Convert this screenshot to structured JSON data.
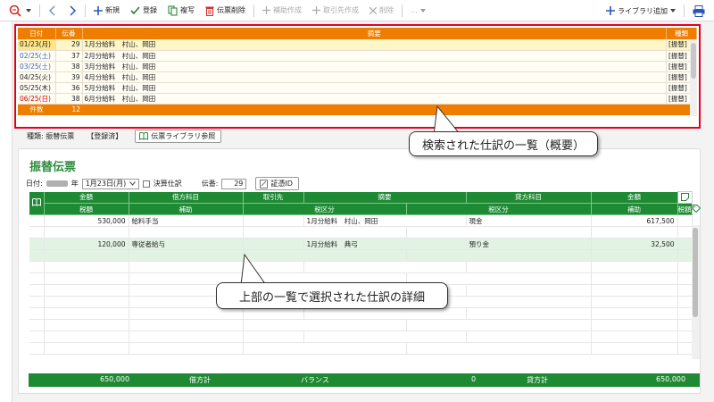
{
  "toolbar": {
    "new": "新規",
    "register": "登録",
    "duplicate": "複写",
    "delete_voucher": "伝票削除",
    "aux_create": "補助作成",
    "partner_create": "取引先作成",
    "delete": "削除",
    "more": "…",
    "library_add": "ライブラリ追加"
  },
  "list": {
    "headers": {
      "date": "日付",
      "no": "伝番",
      "summary": "摘要",
      "type": "種類"
    },
    "rows": [
      {
        "date": "01/23(月)",
        "no": "29",
        "summary": "1月分給料　村山、岡田",
        "type": "[振替]"
      },
      {
        "date": "02/25(土)",
        "no": "37",
        "summary": "2月分給料　村山、岡田",
        "type": "[振替]"
      },
      {
        "date": "03/25(土)",
        "no": "38",
        "summary": "3月分給料　村山、岡田",
        "type": "[振替]"
      },
      {
        "date": "04/25(火)",
        "no": "39",
        "summary": "4月分給料　村山、岡田",
        "type": "[振替]"
      },
      {
        "date": "05/25(木)",
        "no": "36",
        "summary": "5月分給料　村山、岡田",
        "type": "[振替]"
      },
      {
        "date": "06/25(日)",
        "no": "38",
        "summary": "6月分給料　村山、岡田",
        "type": "[振替]"
      }
    ],
    "footer_label": "件数",
    "footer_count": "12"
  },
  "info": {
    "type_label": "種類:",
    "type_value": "振替伝票",
    "status": "【登録済】",
    "library_ref": "伝票ライブラリ参照"
  },
  "voucher": {
    "title": "振替伝票",
    "date_label": "日付:",
    "year_suffix": "年",
    "date_value": "1月23日(月)",
    "closing": "決算仕訳",
    "no_label": "伝番:",
    "no_value": "29",
    "evidence": "証憑ID"
  },
  "grid": {
    "h1": [
      "金額",
      "借方科目",
      "取引先",
      "摘要",
      "貸方科目",
      "金額"
    ],
    "h2": [
      "税額",
      "補助",
      "税区分",
      "税区分",
      "補助",
      "税額"
    ],
    "rows": [
      {
        "amt": "530,000",
        "debit": "給料手当",
        "summary": "1月分給料　村山、岡田",
        "credit": "現金",
        "camt": "617,500"
      },
      {
        "amt": "120,000",
        "debit": "専従者給与",
        "summary": "1月分給料　典弓",
        "credit": "預り金",
        "camt": "32,500"
      }
    ]
  },
  "footer": {
    "debit_total": "650,000",
    "debit_label": "借方計",
    "balance_label": "バランス",
    "balance": "0",
    "credit_label": "貸方計",
    "credit_total": "650,000"
  },
  "callouts": {
    "top": "検索された仕訳の一覧（概要）",
    "bottom": "上部の一覧で選択された仕訳の詳細"
  },
  "colors": {
    "list_header": "#ef7d00",
    "grid_header": "#1e8a33",
    "highlight": "#e6001f"
  }
}
